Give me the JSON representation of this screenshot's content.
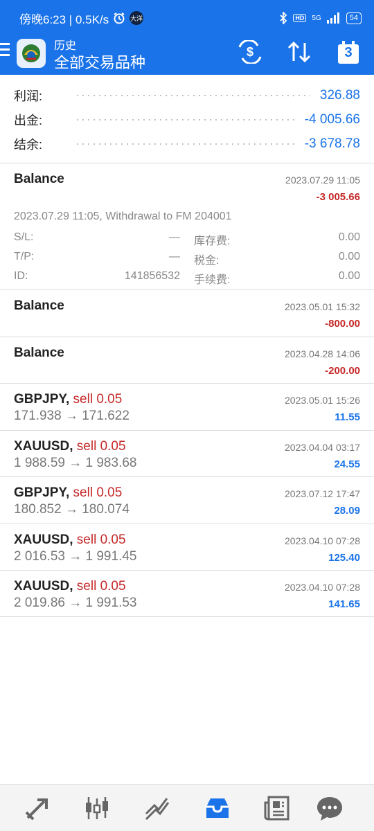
{
  "status_bar": {
    "time": "傍晚6:23 | 0.5K/s",
    "badge": "大洋",
    "hd": "HD",
    "network": "5G",
    "battery": "54"
  },
  "header": {
    "subtitle": "历史",
    "title": "全部交易品种"
  },
  "summary": {
    "profit_label": "利润:",
    "profit_value": "326.88",
    "withdrawal_label": "出金:",
    "withdrawal_value": "-4 005.66",
    "balance_label": "结余:",
    "balance_value": "-3 678.78"
  },
  "calendar_day": "3",
  "expanded_deal": {
    "title": "Balance",
    "date": "2023.07.29 11:05",
    "amount": "-3 005.66",
    "comment": "2023.07.29 11:05, Withdrawal to FM 204001",
    "sl_label": "S/L:",
    "sl_value": "—",
    "tp_label": "T/P:",
    "tp_value": "—",
    "id_label": "ID:",
    "id_value": "141856532",
    "swap_label": "库存费:",
    "swap_value": "0.00",
    "tax_label": "税金:",
    "tax_value": "0.00",
    "fee_label": "手续费:",
    "fee_value": "0.00"
  },
  "balances": [
    {
      "title": "Balance",
      "date": "2023.05.01 15:32",
      "amount": "-800.00"
    },
    {
      "title": "Balance",
      "date": "2023.04.28 14:06",
      "amount": "-200.00"
    }
  ],
  "trades": [
    {
      "symbol": "GBPJPY,",
      "side": "sell 0.05",
      "prices": "171.938 → 171.622",
      "date": "2023.05.01 15:26",
      "profit": "11.55"
    },
    {
      "symbol": "XAUUSD,",
      "side": "sell 0.05",
      "prices": "1 988.59 → 1 983.68",
      "date": "2023.04.04 03:17",
      "profit": "24.55"
    },
    {
      "symbol": "GBPJPY,",
      "side": "sell 0.05",
      "prices": "180.852 → 180.074",
      "date": "2023.07.12 17:47",
      "profit": "28.09"
    },
    {
      "symbol": "XAUUSD,",
      "side": "sell 0.05",
      "prices": "2 016.53 → 1 991.45",
      "date": "2023.04.10 07:28",
      "profit": "125.40"
    },
    {
      "symbol": "XAUUSD,",
      "side": "sell 0.05",
      "prices": "2 019.86 → 1 991.53",
      "date": "2023.04.10 07:28",
      "profit": "141.65"
    }
  ],
  "icons": {
    "nav": [
      "quotes-icon",
      "chart-icon",
      "trade-icon",
      "history-icon",
      "news-icon",
      "chat-icon"
    ],
    "active": "history-icon"
  },
  "colors": {
    "accent": "#1a73e8",
    "negative": "#c62828"
  }
}
